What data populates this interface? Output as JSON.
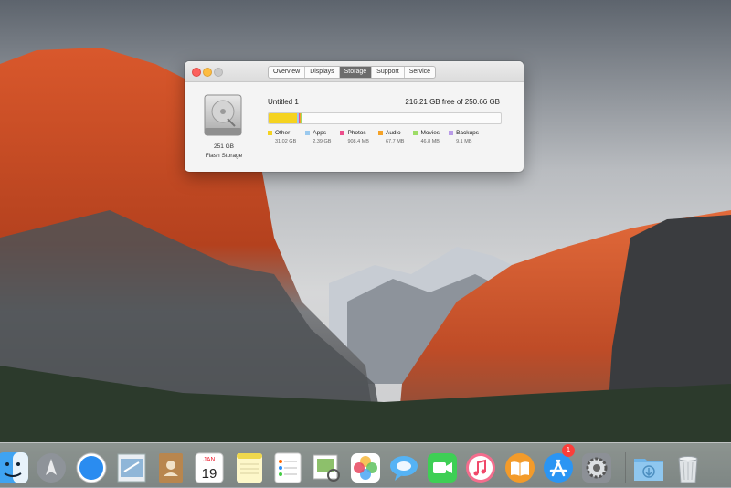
{
  "window": {
    "tabs": [
      {
        "label": "Overview",
        "active": false
      },
      {
        "label": "Displays",
        "active": false
      },
      {
        "label": "Storage",
        "active": true
      },
      {
        "label": "Support",
        "active": false
      },
      {
        "label": "Service",
        "active": false
      }
    ],
    "disk": {
      "icon": "hard-drive-icon",
      "size_label": "251 GB",
      "type_label": "Flash Storage"
    },
    "volume": {
      "name": "Untitled 1",
      "free_text": "216.21 GB free of 250.66 GB",
      "capacity_gb": 250.66,
      "categories": [
        {
          "name": "Other",
          "size": "31.02 GB",
          "gb": 31.02,
          "color": "#f5d320"
        },
        {
          "name": "Apps",
          "size": "2.39 GB",
          "gb": 2.39,
          "color": "#9ac9ee"
        },
        {
          "name": "Photos",
          "size": "908.4 MB",
          "gb": 0.9084,
          "color": "#ec4f8c"
        },
        {
          "name": "Audio",
          "size": "67.7 MB",
          "gb": 0.0677,
          "color": "#f4a227"
        },
        {
          "name": "Movies",
          "size": "46.8 MB",
          "gb": 0.0468,
          "color": "#9ddc66"
        },
        {
          "name": "Backups",
          "size": "9.1 MB",
          "gb": 0.0091,
          "color": "#b99be8"
        }
      ]
    }
  },
  "dock": {
    "items": [
      {
        "name": "finder-icon"
      },
      {
        "name": "launchpad-icon"
      },
      {
        "name": "safari-icon"
      },
      {
        "name": "mail-icon"
      },
      {
        "name": "contacts-icon"
      },
      {
        "name": "calendar-icon",
        "month": "JAN",
        "day": "19"
      },
      {
        "name": "notes-icon"
      },
      {
        "name": "reminders-icon"
      },
      {
        "name": "preview-icon"
      },
      {
        "name": "photos-icon"
      },
      {
        "name": "messages-icon"
      },
      {
        "name": "facetime-icon"
      },
      {
        "name": "itunes-icon"
      },
      {
        "name": "ibooks-icon"
      },
      {
        "name": "app-store-icon",
        "badge": "1"
      },
      {
        "name": "system-preferences-icon"
      },
      {
        "name": "downloads-folder-icon"
      },
      {
        "name": "trash-icon"
      }
    ]
  }
}
